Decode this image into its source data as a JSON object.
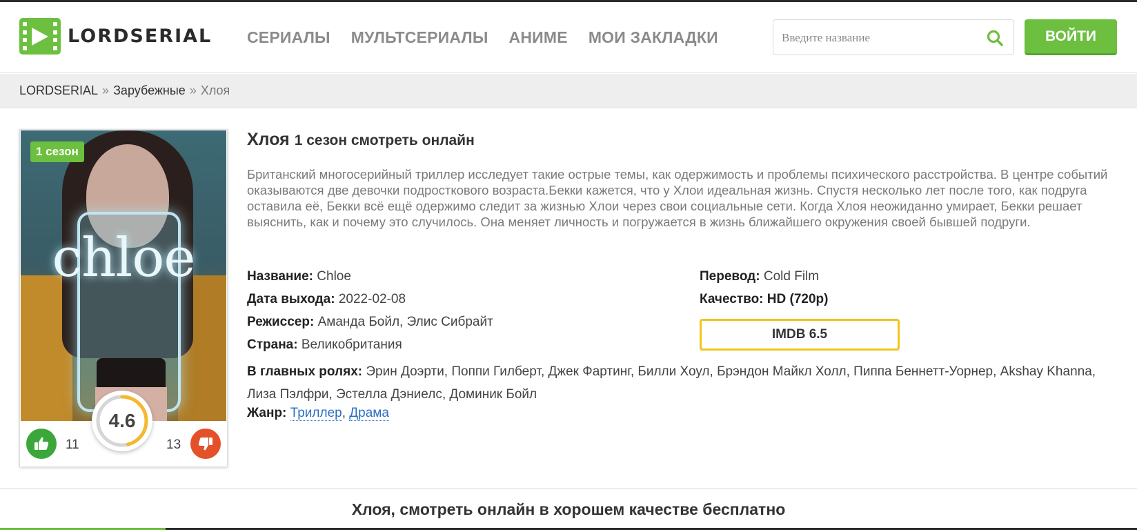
{
  "header": {
    "logo_text": "LORDSERIAL",
    "nav": [
      "СЕРИАЛЫ",
      "МУЛЬТСЕРИАЛЫ",
      "АНИМЕ",
      "МОИ ЗАКЛАДКИ"
    ],
    "search_placeholder": "Введите название",
    "login_label": "ВОЙТИ"
  },
  "breadcrumb": {
    "items": [
      "LORDSERIAL",
      "Зарубежные"
    ],
    "separator": "»",
    "current": "Хлоя"
  },
  "poster": {
    "title_art": "chloe",
    "season_badge": "1 сезон",
    "rating": "4.6",
    "rating_fraction": 0.46,
    "likes": "11",
    "dislikes": "13"
  },
  "title": {
    "main": "Хлоя",
    "sub": "1 сезон смотреть онлайн"
  },
  "description": "Британский многосерийный триллер исследует такие острые темы, как одержимость и проблемы психического расстройства. В центре событий оказываются две девочки подросткового возраста.Бекки кажется, что у Хлои идеальная жизнь. Спустя несколько лет после того, как подруга оставила её, Бекки всё ещё одержимо следит за жизнью Хлои через свои социальные сети. Когда Хлоя неожиданно умирает, Бекки решает выяснить, как и почему это случилось. Она меняет личность и погружается в жизнь ближайшего окружения своей бывшей подруги.",
  "info": {
    "name_label": "Название:",
    "name_value": "Chloe",
    "date_label": "Дата выхода:",
    "date_value": "2022-02-08",
    "director_label": "Режиссер:",
    "director_value": "Аманда Бойл, Элис Сибрайт",
    "country_label": "Страна:",
    "country_value": "Великобритания",
    "translation_label": "Перевод:",
    "translation_value": "Cold Film",
    "quality_label": "Качество:",
    "quality_value": "HD (720p)",
    "imdb": "IMDB 6.5",
    "cast_label": "В главных ролях:",
    "cast_value": "Эрин Доэрти, Поппи Гилберт, Джек Фартинг, Билли Хоул, Брэндон Майкл Холл, Пиппа Беннетт-Уорнер, Akshay Khanna, Лиза Пэлфри, Эстелла Дэниелс, Доминик Бойл",
    "genre_label": "Жанр:",
    "genres": [
      "Триллер",
      "Драма"
    ]
  },
  "bottom_title": "Хлоя, смотреть онлайн в хорошем качестве бесплатно",
  "colors": {
    "accent": "#6cbf3f",
    "like": "#3ba73b",
    "dislike": "#e3502a",
    "imdb_border": "#f0c419",
    "rating_arc": "#f5b82e",
    "link": "#2c6fc2"
  }
}
